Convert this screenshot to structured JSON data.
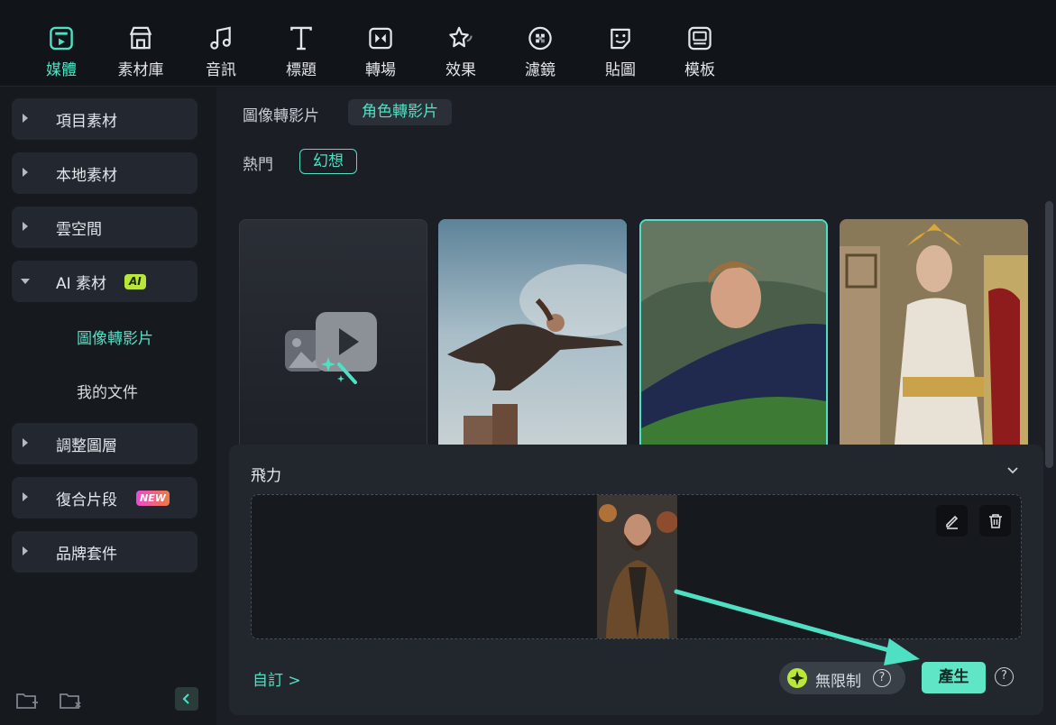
{
  "toolbar": {
    "items": [
      {
        "label": "媒體",
        "icon": "media-icon",
        "active": true
      },
      {
        "label": "素材庫",
        "icon": "store-icon"
      },
      {
        "label": "音訊",
        "icon": "music-note-icon"
      },
      {
        "label": "標題",
        "icon": "text-t-icon"
      },
      {
        "label": "轉場",
        "icon": "transition-icon"
      },
      {
        "label": "效果",
        "icon": "effects-star-icon"
      },
      {
        "label": "濾鏡",
        "icon": "filter-icon"
      },
      {
        "label": "貼圖",
        "icon": "sticker-icon"
      },
      {
        "label": "模板",
        "icon": "template-icon"
      }
    ],
    "accent": "#4fe0c4"
  },
  "sidebar": {
    "items": [
      {
        "label": "項目素材"
      },
      {
        "label": "本地素材"
      },
      {
        "label": "雲空間"
      },
      {
        "label": "AI 素材",
        "badge": "AI",
        "expanded": true
      },
      {
        "label": "調整圖層"
      },
      {
        "label": "復合片段",
        "badge": "NEW"
      },
      {
        "label": "品牌套件"
      }
    ],
    "subitems": [
      {
        "label": "圖像轉影片",
        "active": true
      },
      {
        "label": "我的文件"
      }
    ]
  },
  "main": {
    "tabs": [
      {
        "label": "圖像轉影片"
      },
      {
        "label": "角色轉影片",
        "active": true
      }
    ],
    "filters": [
      {
        "label": "熱門"
      },
      {
        "label": "幻想",
        "active": true
      }
    ]
  },
  "panel": {
    "title": "飛力",
    "custom_link": "自訂 >",
    "unlimited_label": "無限制",
    "help": "?",
    "generate_label": "產生"
  }
}
